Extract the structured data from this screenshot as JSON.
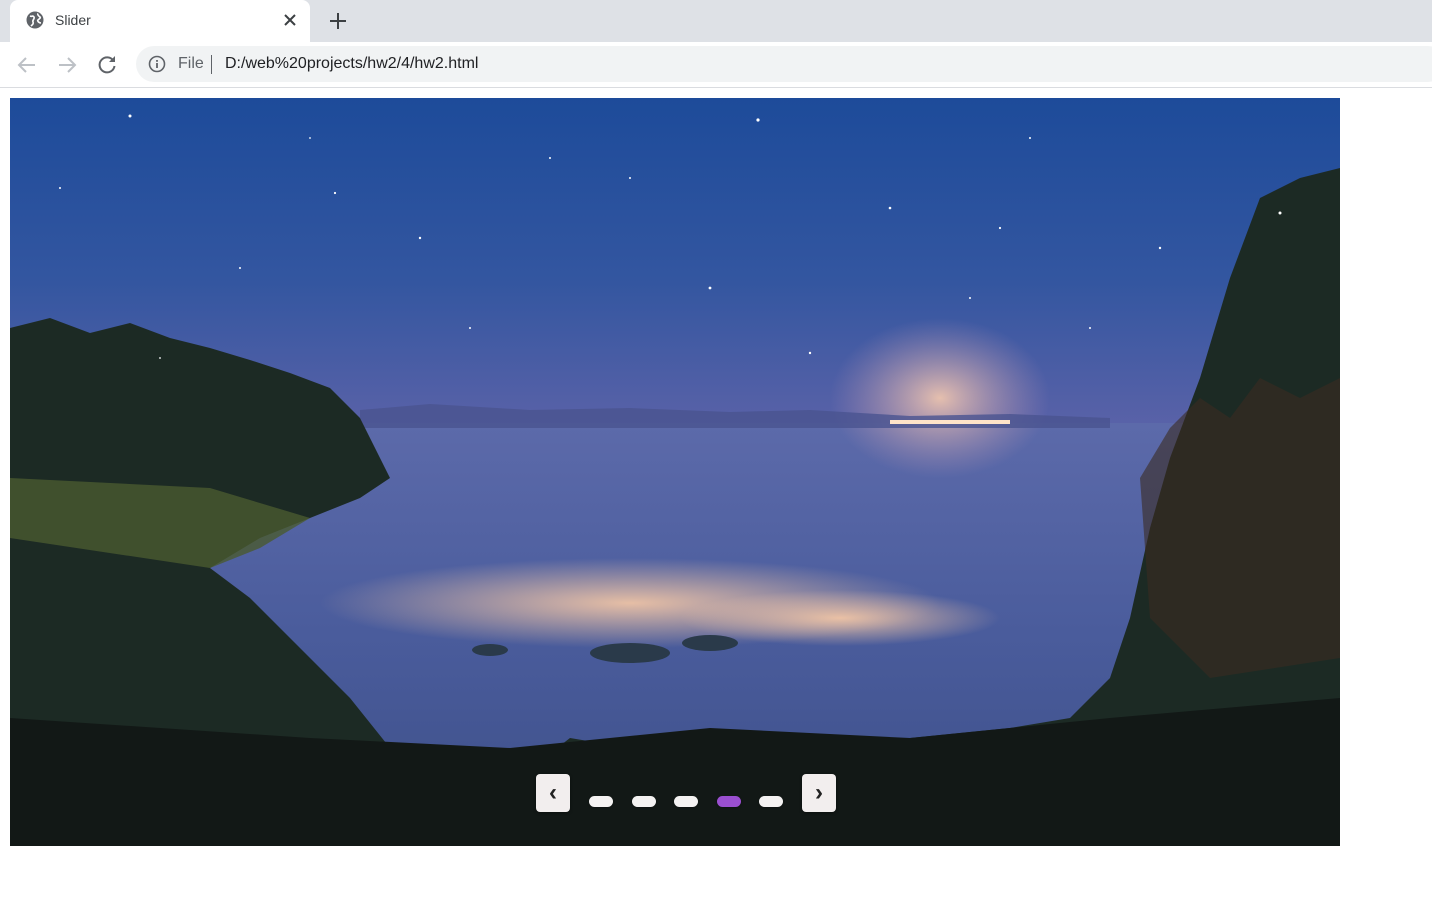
{
  "browser": {
    "tab": {
      "title": "Slider",
      "favicon": "globe-icon",
      "close_icon": "close-icon"
    },
    "new_tab_icon": "plus-icon",
    "toolbar": {
      "back_icon": "back-arrow-icon",
      "forward_icon": "forward-arrow-icon",
      "reload_icon": "reload-icon",
      "info_icon": "info-icon",
      "scheme_label": "File",
      "url": "D:/web%20projects/hw2/4/hw2.html"
    }
  },
  "slider": {
    "image": "night coastal landscape with starry sky, forested cliffs, misty sea and distant glowing lights",
    "prev_label": "‹",
    "next_label": "›",
    "dots": [
      {
        "active": false
      },
      {
        "active": false
      },
      {
        "active": false
      },
      {
        "active": true
      },
      {
        "active": false
      }
    ],
    "active_index": 3,
    "colors": {
      "active_dot": "#9a4fd0",
      "inactive_dot": "#f4f2f2",
      "button_bg": "#f2eeee"
    }
  }
}
